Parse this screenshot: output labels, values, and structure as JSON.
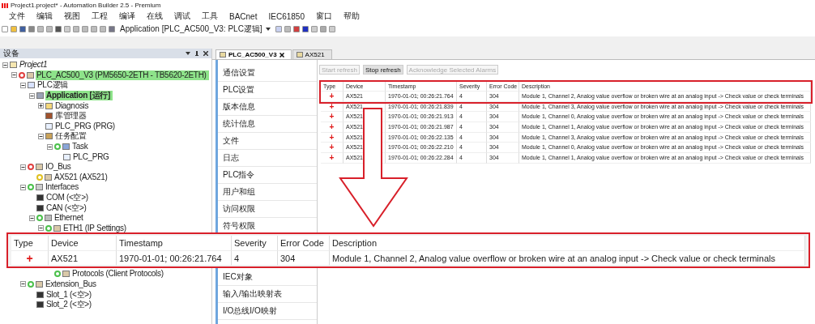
{
  "window": {
    "title": "Project1.project* - Automation Builder 2.5 - Premium"
  },
  "menu": [
    "文件",
    "编辑",
    "视图",
    "工程",
    "编译",
    "在线",
    "调试",
    "工具",
    "BACnet",
    "IEC61850",
    "窗口",
    "帮助"
  ],
  "toolbar": {
    "application": "Application [PLC_AC500_V3: PLC逻辑]"
  },
  "device_panel": {
    "title": "设备",
    "tree": [
      {
        "label": "Project1",
        "kind": "project",
        "expanded": true,
        "children": [
          {
            "label": "PLC_AC500_V3 (PM5650-2ETH - TB5620-2ETH)",
            "kind": "device",
            "color": "#e04040",
            "highlighted": true,
            "expanded": true,
            "children": [
              {
                "label": "PLC逻辑",
                "kind": "logic",
                "expanded": true,
                "children": [
                  {
                    "label": "Application [运行]",
                    "kind": "application",
                    "highlighted": true,
                    "expanded": true,
                    "children": [
                      {
                        "label": "Diagnosis",
                        "kind": "folder",
                        "expanded": false
                      },
                      {
                        "label": "库管理器",
                        "kind": "library"
                      },
                      {
                        "label": "PLC_PRG (PRG)",
                        "kind": "program"
                      },
                      {
                        "label": "任务配置",
                        "kind": "tasks",
                        "expanded": true,
                        "children": [
                          {
                            "label": "Task",
                            "kind": "task",
                            "color": "#4cc04c",
                            "expanded": true,
                            "children": [
                              {
                                "label": "PLC_PRG",
                                "kind": "program"
                              }
                            ]
                          }
                        ]
                      }
                    ]
                  }
                ]
              },
              {
                "label": "IO_Bus",
                "kind": "device",
                "color": "#e04040",
                "expanded": true,
                "children": [
                  {
                    "label": "AX521 (AX521)",
                    "kind": "device",
                    "color": "#e0c020"
                  }
                ]
              },
              {
                "label": "Interfaces",
                "kind": "interface",
                "color": "#4cc04c",
                "expanded": true,
                "children": [
                  {
                    "label": "COM (<空>)",
                    "kind": "slot"
                  },
                  {
                    "label": "CAN (<空>)",
                    "kind": "slot"
                  },
                  {
                    "label": "Ethernet",
                    "kind": "network",
                    "color": "#4cc04c",
                    "expanded": true,
                    "children": [
                      {
                        "label": "ETH1 (IP Settings)",
                        "kind": "device",
                        "color": "#4cc04c",
                        "expanded": true,
                        "children": [
                          {
                            "label": "Protocols (Client Protocols)",
                            "kind": "device",
                            "color": "#4cc04c",
                            "gap_before": true
                          }
                        ]
                      }
                    ]
                  }
                ]
              },
              {
                "label": "Extension_Bus",
                "kind": "device",
                "color": "#4cc04c",
                "expanded": true,
                "children": [
                  {
                    "label": "Slot_1 (<空>)",
                    "kind": "slot"
                  },
                  {
                    "label": "Slot_2 (<空>)",
                    "kind": "slot"
                  }
                ]
              }
            ]
          }
        ]
      }
    ]
  },
  "tabs": [
    {
      "label": "PLC_AC500_V3",
      "selected": true,
      "closable": true
    },
    {
      "label": "AX521",
      "selected": false,
      "closable": false
    }
  ],
  "nav": [
    {
      "label": "通信设置"
    },
    {
      "label": "PLC设置"
    },
    {
      "label": "版本信息"
    },
    {
      "label": "统计信息"
    },
    {
      "label": "文件"
    },
    {
      "label": "日志"
    },
    {
      "label": "PLC指令"
    },
    {
      "label": "用户和组"
    },
    {
      "label": "访问权限"
    },
    {
      "label": "符号权限"
    },
    {
      "label": "IEC对象",
      "gap_before": true
    },
    {
      "label": "输入/输出映射表"
    },
    {
      "label": "I/O总线I/O映射"
    }
  ],
  "buttons": [
    {
      "label": "Start refresh",
      "disabled": true
    },
    {
      "label": "Stop refresh",
      "disabled": false
    },
    {
      "label": "Acknowledge Selected Alarms",
      "disabled": true
    }
  ],
  "table": {
    "columns": [
      "Type",
      "Device",
      "Timestamp",
      "Severity",
      "Error Code",
      "Description"
    ],
    "rows": [
      {
        "type": "+",
        "device": "AX521",
        "timestamp": "1970-01-01; 00:26:21.764",
        "severity": "4",
        "error_code": "304",
        "description": "Module 1, Channel 2, Analog value overflow or broken wire at an analog input -> Check value or check terminals"
      },
      {
        "type": "+",
        "device": "AX521",
        "timestamp": "1970-01-01; 00:26:21.839",
        "severity": "4",
        "error_code": "304",
        "description": "Module 1, Channel 3, Analog value overflow or broken wire at an analog input -> Check value or check terminals"
      },
      {
        "type": "+",
        "device": "AX521",
        "timestamp": "1970-01-01; 00:26:21.913",
        "severity": "4",
        "error_code": "304",
        "description": "Module 1, Channel 0, Analog value overflow or broken wire at an analog input -> Check value or check terminals"
      },
      {
        "type": "+",
        "device": "AX521",
        "timestamp": "1970-01-01; 00:26:21.987",
        "severity": "4",
        "error_code": "304",
        "description": "Module 1, Channel 1, Analog value overflow or broken wire at an analog input -> Check value or check terminals"
      },
      {
        "type": "+",
        "device": "AX521",
        "timestamp": "1970-01-01; 00:26:22.135",
        "severity": "4",
        "error_code": "304",
        "description": "Module 1, Channel 3, Analog value overflow or broken wire at an analog input -> Check value or check terminals"
      },
      {
        "type": "+",
        "device": "AX521",
        "timestamp": "1970-01-01; 00:26:22.210",
        "severity": "4",
        "error_code": "304",
        "description": "Module 1, Channel 0, Analog value overflow or broken wire at an analog input -> Check value or check terminals"
      },
      {
        "type": "+",
        "device": "AX521",
        "timestamp": "1970-01-01; 00:26:22.284",
        "severity": "4",
        "error_code": "304",
        "description": "Module 1, Channel 1, Analog value overflow or broken wire at an analog input -> Check value or check terminals"
      }
    ]
  },
  "zoom_callout": {
    "columns": [
      "Type",
      "Device",
      "Timestamp",
      "Severity",
      "Error Code",
      "Description"
    ],
    "row": {
      "type": "+",
      "device": "AX521",
      "timestamp": "1970-01-01; 00:26:21.764",
      "severity": "4",
      "error_code": "304",
      "description": "Module 1, Channel 2, Analog value overflow or broken wire at an analog input -> Check value or check terminals"
    }
  }
}
